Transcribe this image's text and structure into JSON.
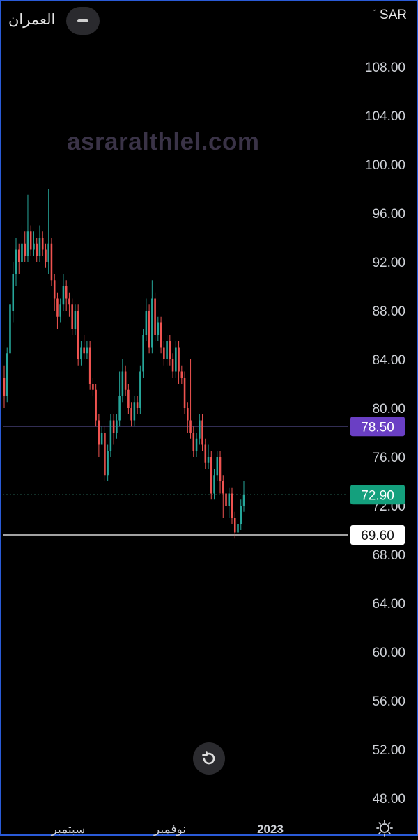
{
  "header": {
    "symbol_name": "العمران",
    "currency": "SAR",
    "chevron_icon": "chevron-down-icon",
    "collapse_icon": "minus-icon"
  },
  "watermark": "asraralthlel.com",
  "controls": {
    "reset_icon": "rotate-ccw-icon",
    "theme_icon": "sun-icon"
  },
  "colors": {
    "background": "#000000",
    "up": "#26a69a",
    "down": "#ef5350",
    "accent_purple": "#6a3fc4",
    "price_green": "#14a07d"
  },
  "chart_data": {
    "type": "candlestick",
    "ylim": [
      46,
      112
    ],
    "y_ticks": [
      "108.00",
      "104.00",
      "100.00",
      "96.00",
      "92.00",
      "88.00",
      "84.00",
      "80.00",
      "76.00",
      "72.00",
      "68.00",
      "64.00",
      "60.00",
      "56.00",
      "52.00",
      "48.00"
    ],
    "x_ticks": [
      "سبتمبر",
      "نوفمبر",
      "2023"
    ],
    "price_labels": [
      {
        "label": "78.50",
        "value": 78.5,
        "style": "purple",
        "line": "solid"
      },
      {
        "label": "72.90",
        "value": 72.9,
        "style": "green",
        "line": "dotted"
      },
      {
        "label": "69.60",
        "value": 69.6,
        "style": "white",
        "line": "solid"
      }
    ],
    "candles": [
      [
        82.5,
        81,
        83.5,
        80
      ],
      [
        81,
        84.5,
        85,
        80.5
      ],
      [
        84.5,
        88.5,
        89,
        84
      ],
      [
        88,
        91,
        92,
        87
      ],
      [
        91,
        93,
        94,
        90
      ],
      [
        93,
        92,
        93.5,
        91
      ],
      [
        92,
        93.5,
        95,
        91.5
      ],
      [
        93.5,
        92.5,
        94.5,
        92
      ],
      [
        92.5,
        94.5,
        97.5,
        92
      ],
      [
        94.5,
        93,
        95,
        92.5
      ],
      [
        93,
        93.5,
        94.5,
        92.5
      ],
      [
        93.5,
        92.5,
        94,
        92
      ],
      [
        92.5,
        94,
        95,
        92
      ],
      [
        94,
        93,
        94.5,
        92.5
      ],
      [
        93,
        92,
        93.5,
        91.5
      ],
      [
        92,
        93.5,
        98,
        91
      ],
      [
        93.5,
        90.5,
        94,
        90
      ],
      [
        90.5,
        89,
        91,
        88
      ],
      [
        89,
        87.5,
        89.5,
        86.5
      ],
      [
        87.5,
        88.5,
        89,
        87
      ],
      [
        88.5,
        90,
        91,
        88
      ],
      [
        90,
        89,
        90.5,
        88
      ],
      [
        89,
        88.5,
        89.5,
        87.5
      ],
      [
        88.5,
        86.5,
        89,
        86
      ],
      [
        86.5,
        88,
        88.5,
        86
      ],
      [
        88,
        84,
        88.5,
        83.5
      ],
      [
        84,
        85,
        85.5,
        83.5
      ],
      [
        85,
        84.5,
        86,
        84
      ],
      [
        84.5,
        85,
        85.5,
        84
      ],
      [
        85,
        82,
        85.5,
        81.5
      ],
      [
        82,
        81.5,
        82.5,
        81
      ],
      [
        81.5,
        79,
        82,
        78.5
      ],
      [
        79,
        77,
        79.5,
        76
      ],
      [
        77,
        78,
        78.5,
        77
      ],
      [
        78,
        74.5,
        78.5,
        74
      ],
      [
        74.5,
        76.5,
        77,
        74
      ],
      [
        76.5,
        79,
        79.5,
        76
      ],
      [
        79,
        78,
        79.5,
        77
      ],
      [
        78,
        79,
        79.5,
        77.5
      ],
      [
        79,
        81,
        83,
        78.5
      ],
      [
        81,
        83,
        84,
        80.5
      ],
      [
        83,
        81.5,
        83.5,
        81
      ],
      [
        81.5,
        80,
        82,
        79.5
      ],
      [
        80,
        79,
        80.5,
        78.5
      ],
      [
        79,
        80.5,
        81,
        78.5
      ],
      [
        80.5,
        80,
        81,
        79.5
      ],
      [
        80,
        83,
        83.5,
        79.5
      ],
      [
        83,
        86,
        86.5,
        82.5
      ],
      [
        86,
        88,
        89,
        85.5
      ],
      [
        88,
        85,
        88.5,
        84.5
      ],
      [
        85,
        89,
        90.5,
        84.5
      ],
      [
        89,
        86,
        89.5,
        85.5
      ],
      [
        86,
        87,
        87.5,
        85.5
      ],
      [
        87,
        85,
        87.5,
        84.5
      ],
      [
        85,
        84,
        85.5,
        83.5
      ],
      [
        84,
        85.5,
        86,
        83.5
      ],
      [
        85.5,
        84,
        86,
        83.5
      ],
      [
        84,
        83,
        84.5,
        82.5
      ],
      [
        83,
        85,
        85.5,
        82.5
      ],
      [
        85,
        83,
        85.5,
        82
      ],
      [
        83,
        82.5,
        83.5,
        82
      ],
      [
        82.5,
        80,
        83,
        79.5
      ],
      [
        80,
        79,
        80.5,
        78
      ],
      [
        79,
        78,
        84,
        77.5
      ],
      [
        78,
        76.5,
        78.5,
        76
      ],
      [
        76.5,
        77.5,
        78,
        76
      ],
      [
        77.5,
        79,
        79.5,
        77
      ],
      [
        79,
        77,
        79.5,
        76.5
      ],
      [
        77,
        75.5,
        77.5,
        75
      ],
      [
        75.5,
        76,
        77,
        75
      ],
      [
        76,
        73,
        76.5,
        72.5
      ],
      [
        73,
        74.5,
        75,
        72.5
      ],
      [
        74.5,
        76,
        76.5,
        74
      ],
      [
        76,
        74,
        76.5,
        73
      ],
      [
        74,
        73,
        74.5,
        71
      ],
      [
        73,
        72,
        73.5,
        71.5
      ],
      [
        72,
        73,
        73.5,
        71
      ],
      [
        73,
        71,
        73.5,
        70.5
      ],
      [
        71,
        69.8,
        71.5,
        69.3
      ],
      [
        69.8,
        70.5,
        71,
        69.5
      ],
      [
        70.5,
        72,
        72.5,
        70
      ],
      [
        72,
        72.9,
        74,
        71.5
      ]
    ]
  }
}
